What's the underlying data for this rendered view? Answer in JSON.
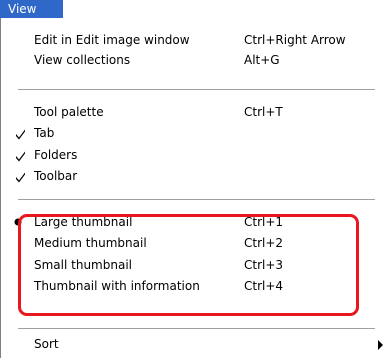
{
  "menubar": {
    "active_menu": "View",
    "highlight_color": "#2f68c8"
  },
  "menu": {
    "groups": [
      {
        "items": [
          {
            "label": "Edit in Edit image window",
            "shortcut": "Ctrl+Right Arrow"
          },
          {
            "label": "View collections",
            "shortcut": "Alt+G"
          }
        ]
      },
      {
        "items": [
          {
            "label": "Tool palette",
            "shortcut": "Ctrl+T",
            "checked": false
          },
          {
            "label": "Tab",
            "checked": true
          },
          {
            "label": "Folders",
            "checked": true
          },
          {
            "label": "Toolbar",
            "checked": true
          }
        ]
      },
      {
        "items": [
          {
            "label": "Large thumbnail",
            "shortcut": "Ctrl+1",
            "selected": true
          },
          {
            "label": "Medium thumbnail",
            "shortcut": "Ctrl+2",
            "selected": false
          },
          {
            "label": "Small thumbnail",
            "shortcut": "Ctrl+3",
            "selected": false
          },
          {
            "label": "Thumbnail with information",
            "shortcut": "Ctrl+4",
            "selected": false
          }
        ]
      },
      {
        "items": [
          {
            "label": "Sort",
            "has_submenu": true
          }
        ]
      }
    ],
    "check_icon": "checkmark-icon",
    "radio_icon": "radio-dot-icon",
    "submenu_icon": "submenu-arrow-icon",
    "annotation_color": "#e8161e"
  }
}
